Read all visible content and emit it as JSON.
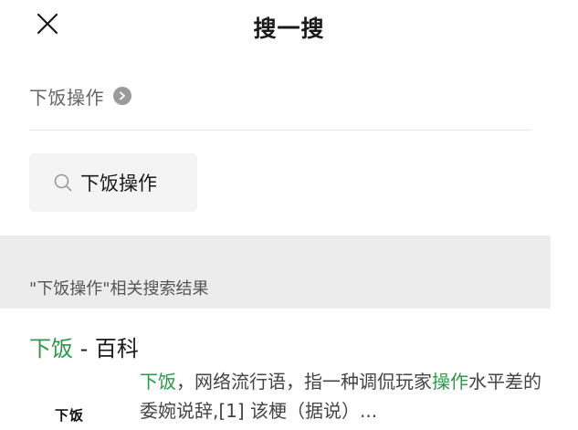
{
  "header": {
    "title": "搜一搜",
    "close_icon": "close-icon"
  },
  "query": {
    "text": "下饭操作",
    "arrow_icon": "chevron-right-circle-icon"
  },
  "search_chip": {
    "icon": "search-icon",
    "text": "下饭操作"
  },
  "results_section": {
    "label": "\"下饭操作\"相关搜索结果"
  },
  "result": {
    "title_highlight": "下饭",
    "title_rest": " - 百科",
    "snippet": {
      "hl1": "下饭",
      "part1": "，网络流行语，指一种调侃玩家",
      "hl2": "操作",
      "part2": "水平差的委婉说辞,[1] 该梗（据说）..."
    },
    "thumbnail_text": "下饭"
  },
  "colors": {
    "highlight": "#2b9948",
    "band": "#ececec",
    "chip_bg": "#f4f4f4"
  }
}
